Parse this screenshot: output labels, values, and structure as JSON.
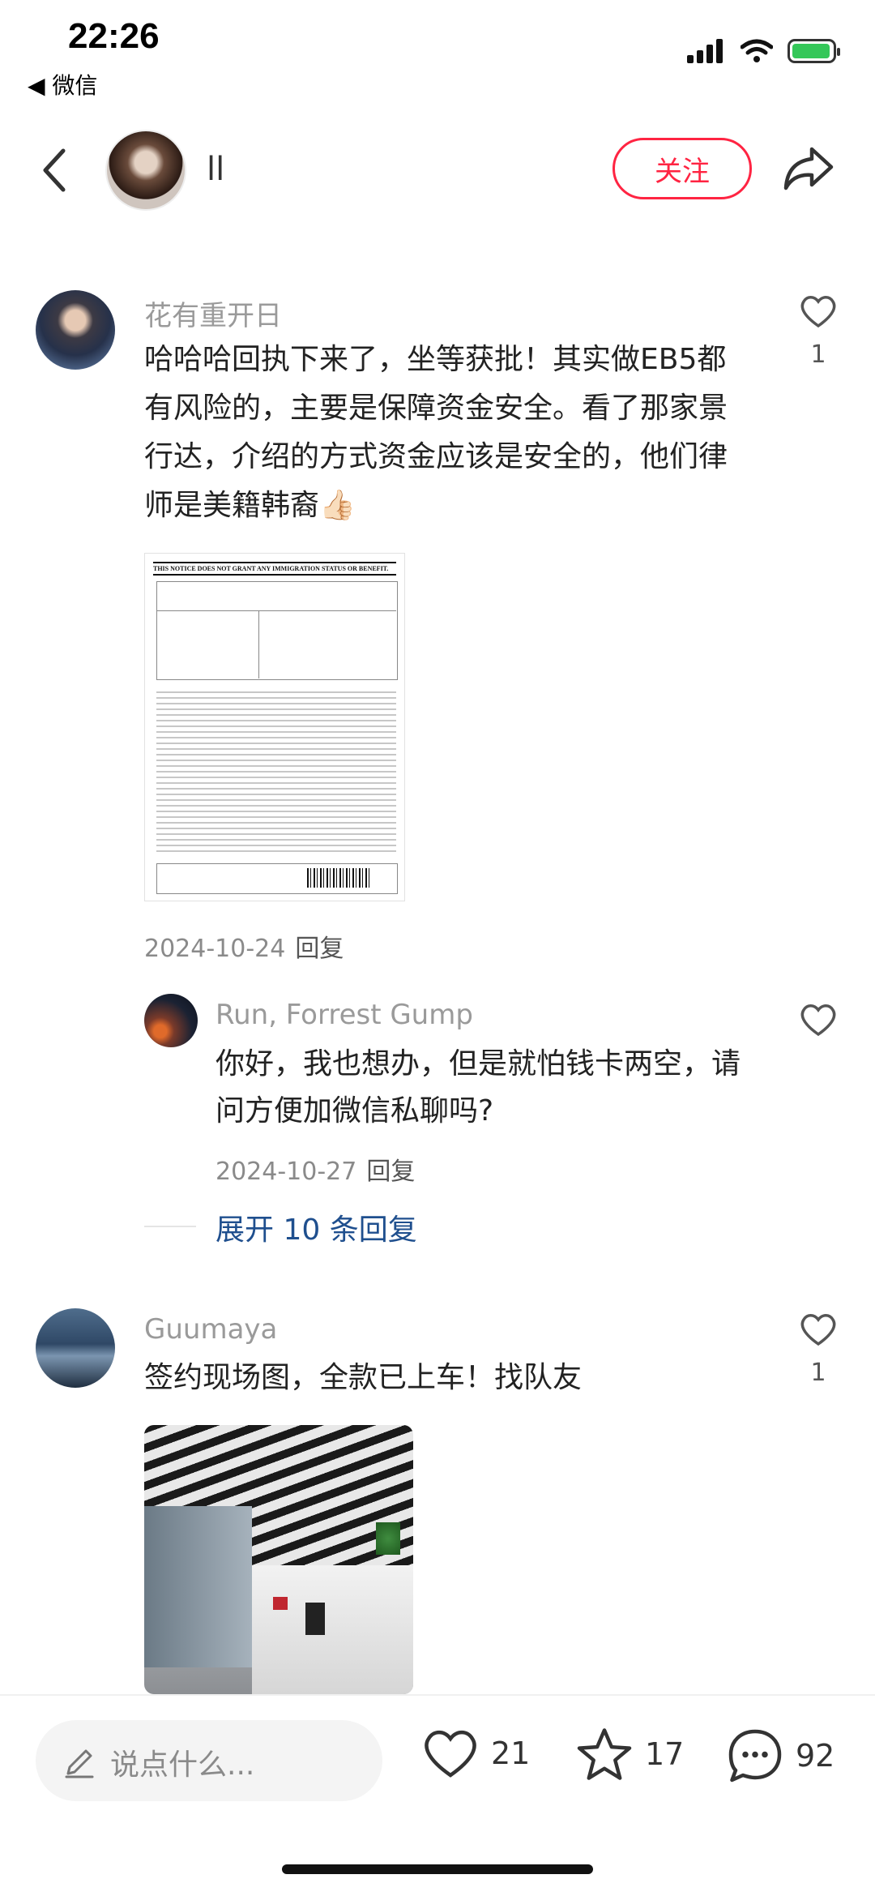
{
  "status_bar": {
    "time": "22:26",
    "back_app": "◀ 微信"
  },
  "header": {
    "author_name": "ll",
    "follow_label": "关注"
  },
  "comments": [
    {
      "author": "花有重开日",
      "text": "哈哈哈回执下来了，坐等获批！其实做EB5都有风险的，主要是保障资金安全。看了那家景行达，介绍的方式资金应该是安全的，他们律师是美籍韩裔👍🏻",
      "image_header": "THIS NOTICE DOES NOT GRANT ANY IMMIGRATION STATUS OR BENEFIT.",
      "date": "2024-10-24",
      "reply_label": "回复",
      "likes": "1",
      "replies": [
        {
          "author": "Run, Forrest Gump",
          "text": "你好，我也想办，但是就怕钱卡两空，请问方便加微信私聊吗?",
          "date": "2024-10-27",
          "reply_label": "回复"
        }
      ],
      "expand_label": "展开 10 条回复"
    },
    {
      "author": "Guumaya",
      "text": "签约现场图，全款已上车！找队友",
      "likes": "1"
    }
  ],
  "bottom_bar": {
    "input_placeholder": "说点什么...",
    "likes": "21",
    "favorites": "17",
    "comments": "92"
  }
}
